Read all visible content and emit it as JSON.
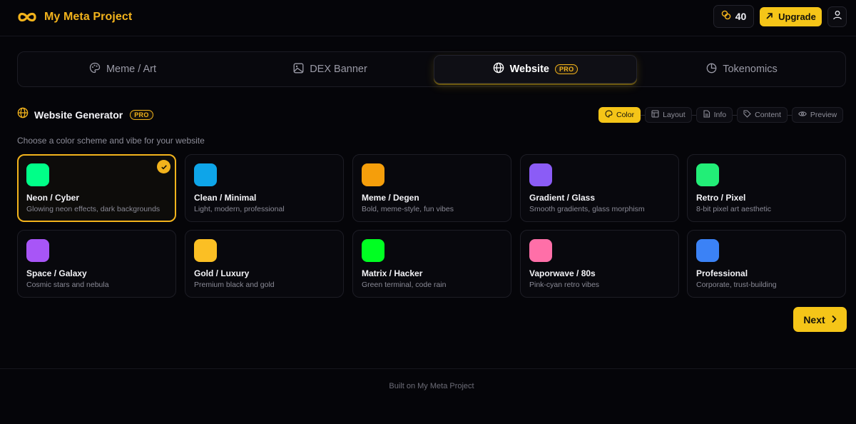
{
  "header": {
    "brand_name": "My Meta Project",
    "credits": "40",
    "upgrade_label": "Upgrade"
  },
  "tabs": [
    {
      "label": "Meme / Art",
      "icon": "palette-icon"
    },
    {
      "label": "DEX Banner",
      "icon": "image-icon"
    },
    {
      "label": "Website",
      "icon": "globe-icon",
      "badge": "PRO",
      "active": true
    },
    {
      "label": "Tokenomics",
      "icon": "pie-chart-icon"
    }
  ],
  "generator": {
    "title": "Website Generator",
    "badge": "PRO",
    "subtitle": "Choose a color scheme and vibe for your website"
  },
  "steps": [
    {
      "label": "Color",
      "icon": "palette-icon",
      "active": true
    },
    {
      "label": "Layout",
      "icon": "layout-icon"
    },
    {
      "label": "Info",
      "icon": "file-icon"
    },
    {
      "label": "Content",
      "icon": "tag-icon"
    },
    {
      "label": "Preview",
      "icon": "eye-icon"
    }
  ],
  "schemes": [
    {
      "name": "Neon / Cyber",
      "desc": "Glowing neon effects, dark backgrounds",
      "color": "#00ff88",
      "selected": true
    },
    {
      "name": "Clean / Minimal",
      "desc": "Light, modern, professional",
      "color": "#0ea5e9"
    },
    {
      "name": "Meme / Degen",
      "desc": "Bold, meme-style, fun vibes",
      "color": "#f59e0b"
    },
    {
      "name": "Gradient / Glass",
      "desc": "Smooth gradients, glass morphism",
      "color": "#8b5cf6"
    },
    {
      "name": "Retro / Pixel",
      "desc": "8-bit pixel art aesthetic",
      "color": "#22ee77"
    },
    {
      "name": "Space / Galaxy",
      "desc": "Cosmic stars and nebula",
      "color": "#a855f7"
    },
    {
      "name": "Gold / Luxury",
      "desc": "Premium black and gold",
      "color": "#fbbf24"
    },
    {
      "name": "Matrix / Hacker",
      "desc": "Green terminal, code rain",
      "color": "#00ff22"
    },
    {
      "name": "Vaporwave / 80s",
      "desc": "Pink-cyan retro vibes",
      "color": "#ff6fa8"
    },
    {
      "name": "Professional",
      "desc": "Corporate, trust-building",
      "color": "#3b82f6"
    }
  ],
  "next_label": "Next",
  "footer": "Built on My Meta Project",
  "colors": {
    "accent": "#f5c518",
    "background": "#050509"
  }
}
